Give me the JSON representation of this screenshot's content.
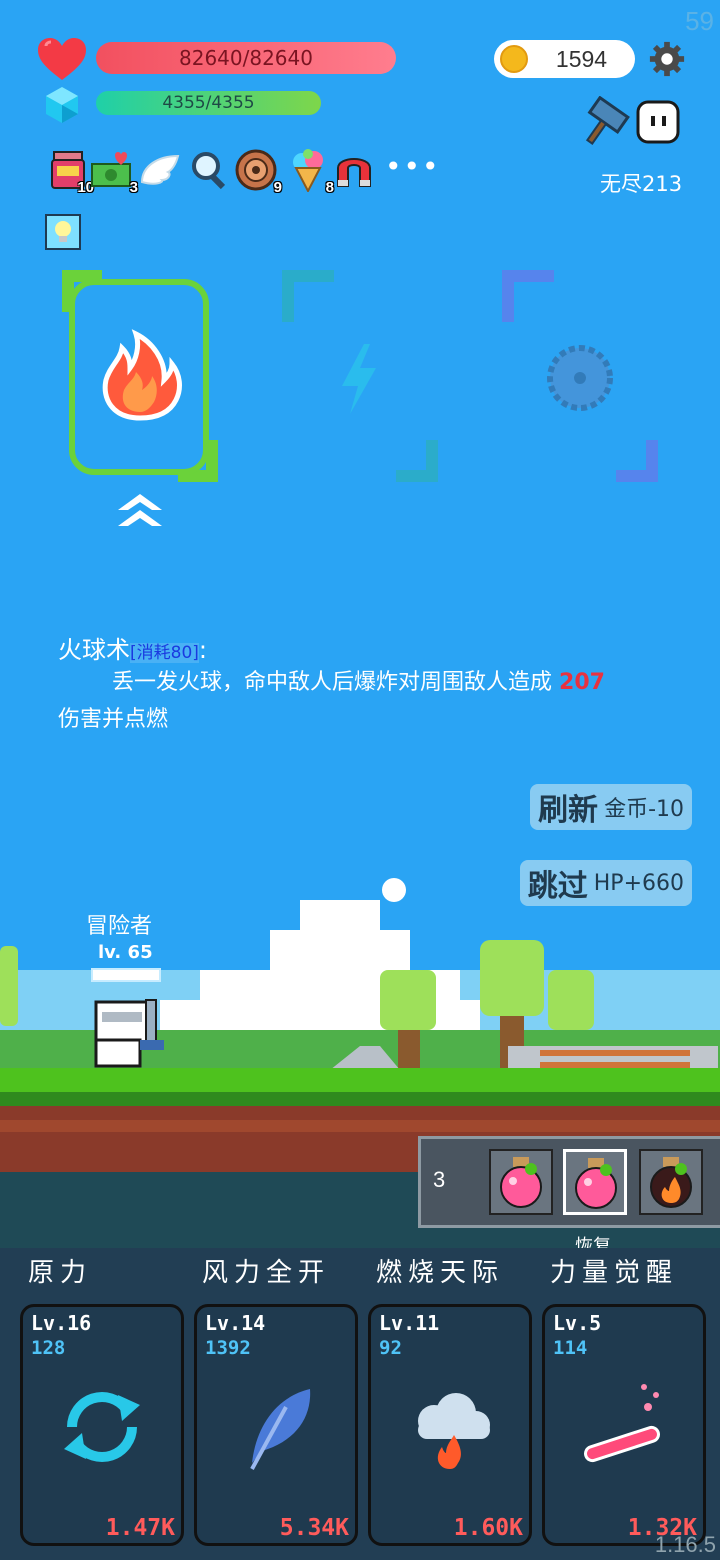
{
  "fps": "59",
  "version": "1.16.5",
  "stats": {
    "hp": "82640/82640",
    "mp": "4355/4355",
    "gold": "1594"
  },
  "mode": "无尽213",
  "items": [
    {
      "icon": "jam-jar-icon",
      "count": "10"
    },
    {
      "icon": "cash-heart-icon",
      "count": "3"
    },
    {
      "icon": "angel-wing-icon",
      "count": ""
    },
    {
      "icon": "magnifier-icon",
      "count": ""
    },
    {
      "icon": "shield-ring-icon",
      "count": "9"
    },
    {
      "icon": "ice-cream-icon",
      "count": "8"
    },
    {
      "icon": "magnet-icon",
      "count": ""
    }
  ],
  "more_label": "•••",
  "skill": {
    "name": "火球术",
    "cost_label": "[消耗80]",
    "colon": ":",
    "desc_before": "丢一发火球，命中敌人后爆炸对周围敌人造成",
    "damage": "207",
    "desc_after": "伤害并点燃"
  },
  "buttons": {
    "refresh": {
      "label": "刷新",
      "cost": "金币-10"
    },
    "skip": {
      "label": "跳过",
      "cost": "HP+660"
    }
  },
  "hero": {
    "name": "冒险者",
    "level": "lv. 65"
  },
  "potions": {
    "count": "3",
    "selected_label": "恢复"
  },
  "abilities": [
    {
      "title": "原力",
      "level": "Lv.16",
      "value": "128",
      "cost": "1.47K",
      "icon": "cycle-icon"
    },
    {
      "title": "风力全开",
      "level": "Lv.14",
      "value": "1392",
      "cost": "5.34K",
      "icon": "feather-icon"
    },
    {
      "title": "燃烧天际",
      "level": "Lv.11",
      "value": "92",
      "cost": "1.60K",
      "icon": "fire-cloud-icon"
    },
    {
      "title": "力量觉醒",
      "level": "Lv.5",
      "value": "114",
      "cost": "1.32K",
      "icon": "potion-tube-icon"
    }
  ]
}
